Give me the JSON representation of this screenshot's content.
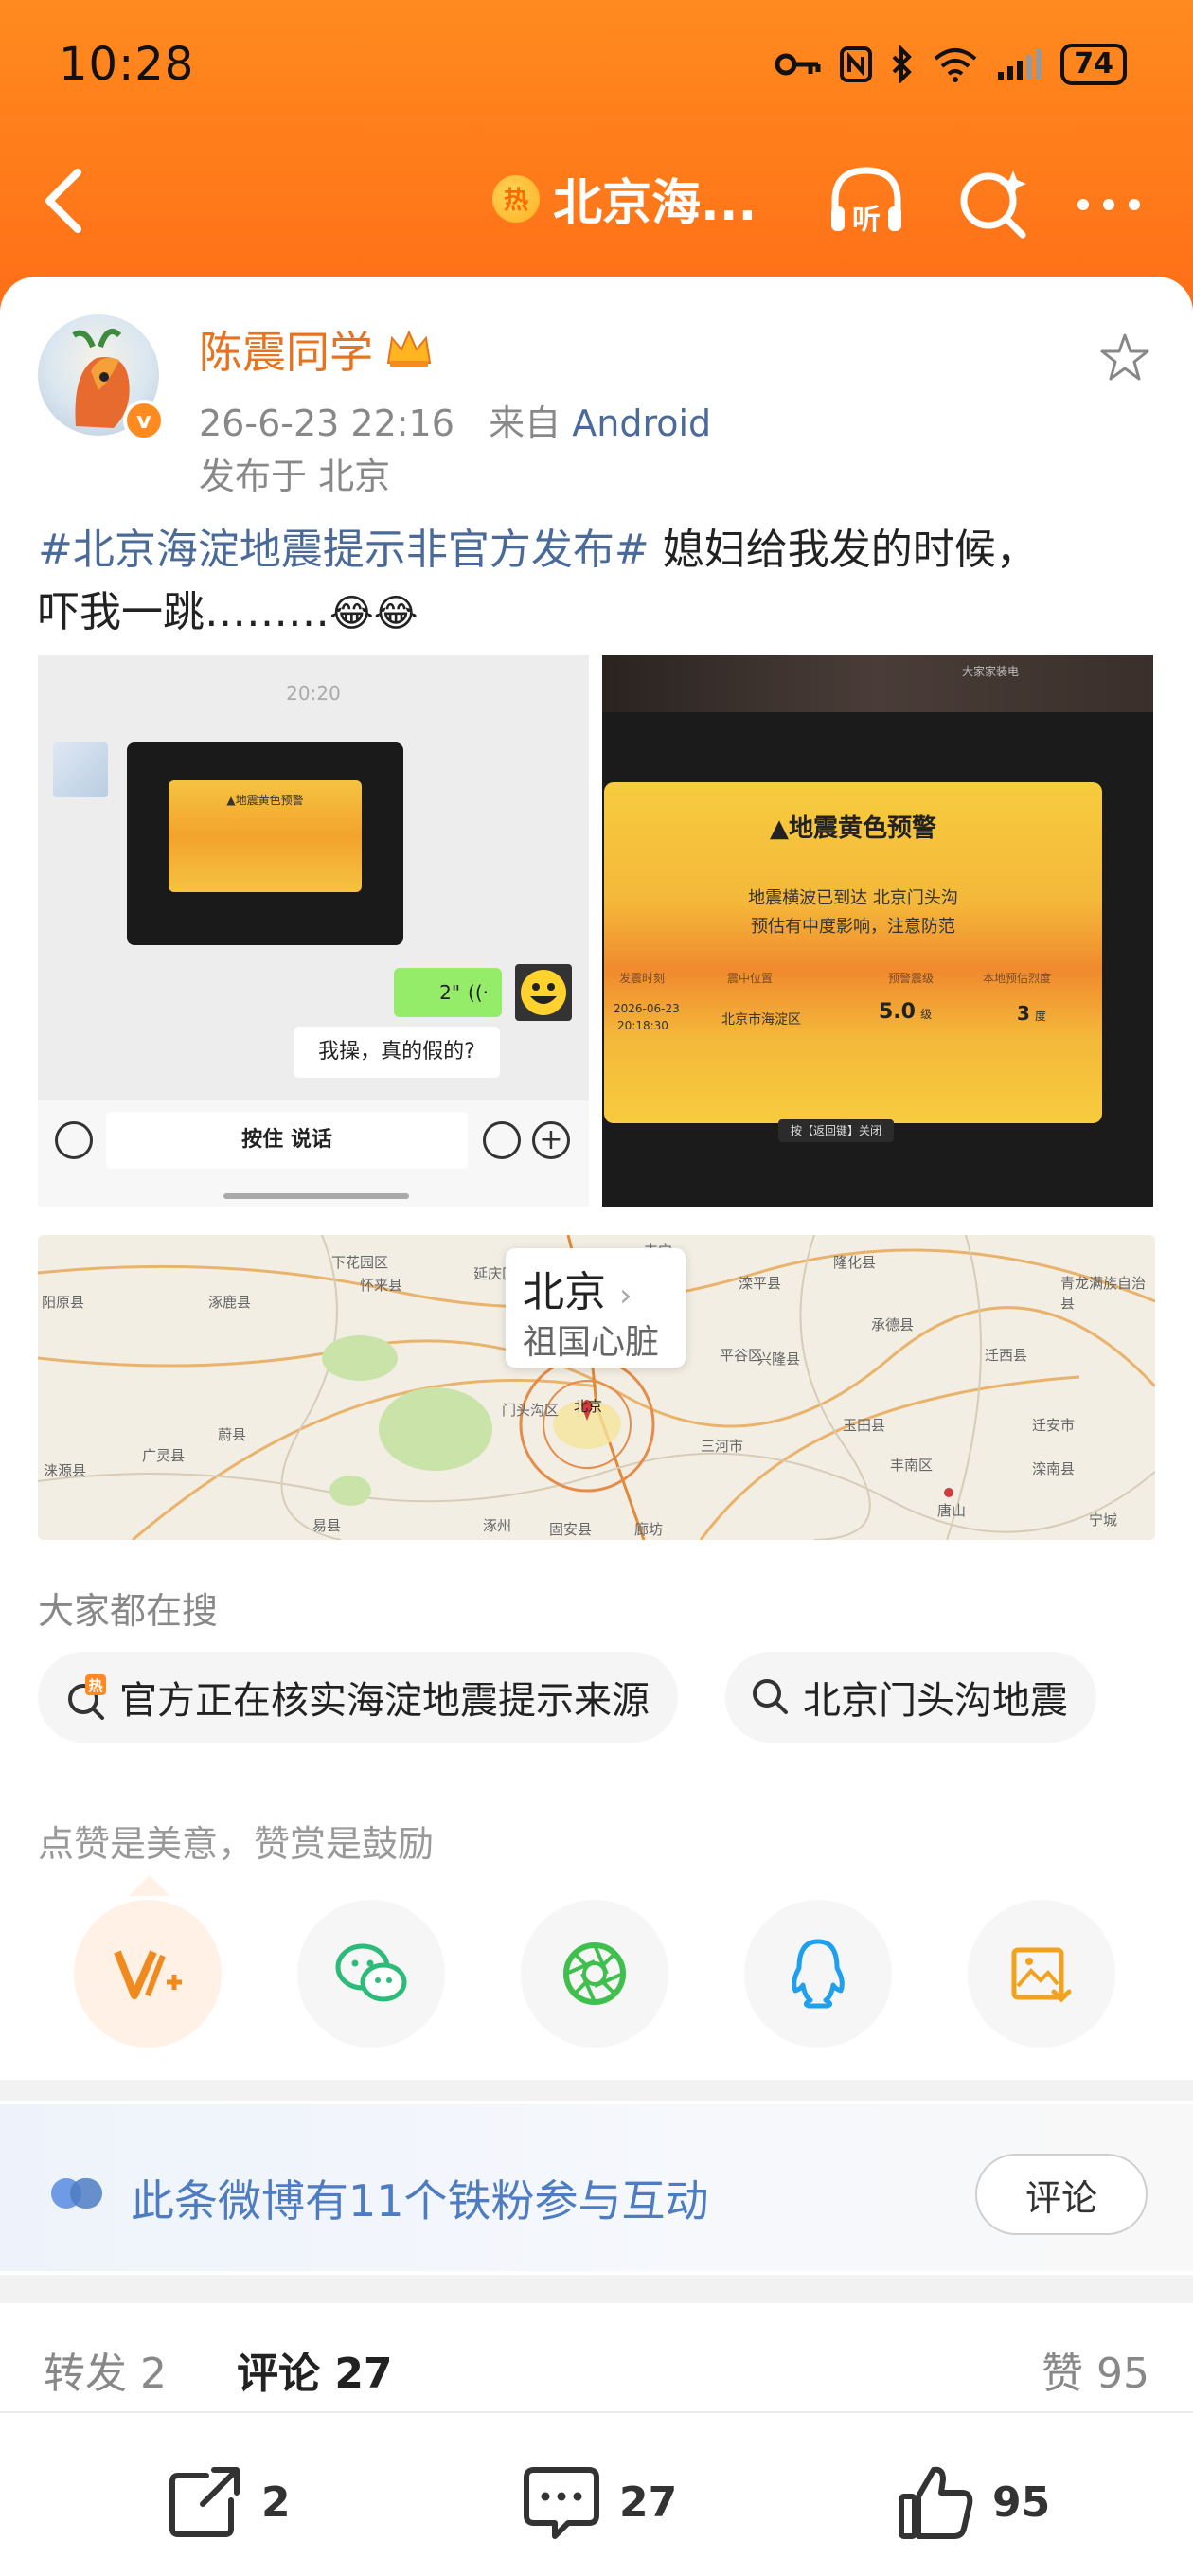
{
  "status_bar": {
    "time": "10:28",
    "battery": "74"
  },
  "nav": {
    "hot_badge": "热",
    "title": "北京海..."
  },
  "post": {
    "author": "陈震同学",
    "avatar_badge": "v",
    "timestamp": "26-6-23 22:16",
    "source_prefix": "来自",
    "source": "Android",
    "location_prefix": "发布于",
    "location": "北京",
    "topic": "#北京海淀地震提示非官方发布#",
    "text_part1": " 媳妇给我发的时候，",
    "text_part2": "吓我一跳………"
  },
  "image1": {
    "time": "20:20",
    "card_title": "▲地震黄色预警",
    "voice_duration": "2\"",
    "reply": "我操，真的假的?",
    "hold_to_talk": "按住 说话"
  },
  "image2": {
    "brand": "大家家装电",
    "alert_title": "▲地震黄色预警",
    "line1": "地震横波已到达 北京门头沟",
    "line2": "预估有中度影响，注意防范",
    "col1_head": "发震时刻",
    "col1_val_a": "2026-06-23",
    "col1_val_b": "20:18:30",
    "col2_head": "震中位置",
    "col2_val": "北京市海淀区",
    "col3_head": "预警震级",
    "col3_val": "5.0",
    "col3_unit": "级",
    "col4_head": "本地预估烈度",
    "col4_val": "3",
    "col4_unit": "度",
    "close_hint": "按【返回键】关闭"
  },
  "map": {
    "popup_title": "北京",
    "popup_sub": "祖国心脏",
    "labels": [
      "下花园区",
      "怀来县",
      "延庆区",
      "隆化县",
      "滦平县",
      "承德县",
      "兴隆县",
      "丰宁",
      "青龙满族自治县",
      "阳原县",
      "涿鹿县",
      "平谷区",
      "迁西县",
      "蔚县",
      "广灵县",
      "涞源县",
      "门头沟区",
      "北京",
      "三河市",
      "玉田县",
      "唐山",
      "易县",
      "涿州",
      "固安县",
      "廊坊",
      "丰南区",
      "滦南县",
      "迁安市",
      "宁城"
    ]
  },
  "search": {
    "label": "大家都在搜",
    "pill1_badge": "热",
    "pill1": "官方正在核实海淀地震提示来源",
    "pill2": "北京门头沟地震"
  },
  "reward": {
    "label": "点赞是美意，赞赏是鼓励"
  },
  "fans": {
    "text": "此条微博有11个铁粉参与互动",
    "comment_button": "评论"
  },
  "tabs": {
    "repost": "转发 2",
    "comments": "评论 27",
    "likes": "赞 95"
  },
  "actions": {
    "repost_count": "2",
    "comment_count": "27",
    "like_count": "95"
  },
  "colors": {
    "header": "#ff7a1a",
    "brand_orange": "#e8731f",
    "link_blue": "#4a6a9a",
    "fans_blue": "#4d7cc2"
  }
}
